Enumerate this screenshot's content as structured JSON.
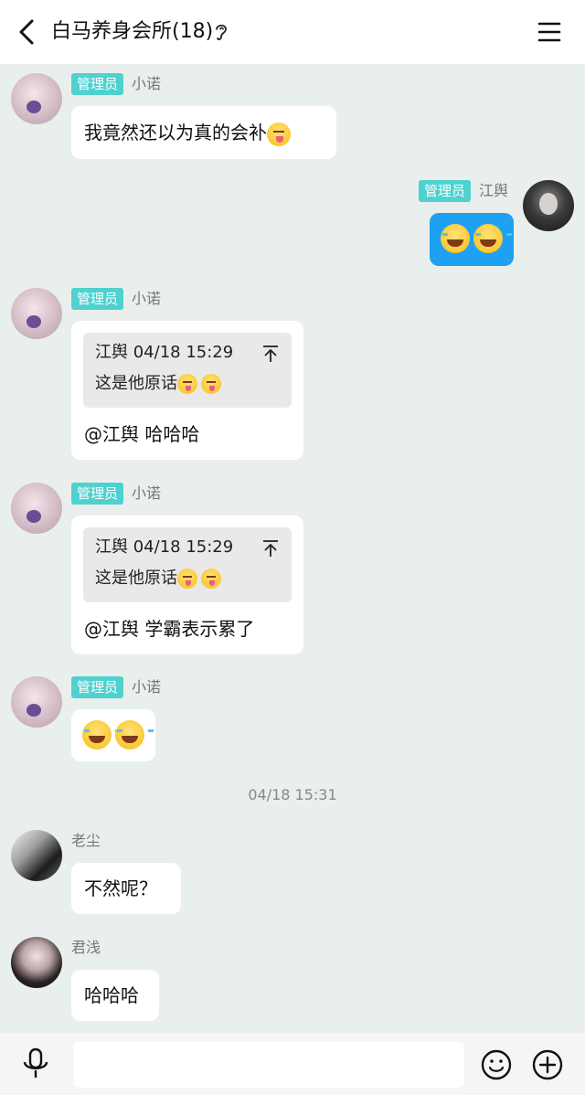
{
  "header": {
    "title": "白马养身会所(18)",
    "back_icon": "chevron-left-icon",
    "status_icon": "ear-icon",
    "menu_icon": "hamburger-menu-icon"
  },
  "badge_label": "管理员",
  "messages": [
    {
      "sender": "小诺",
      "admin": true,
      "side": "left",
      "text": "我竟然还以为真的会补",
      "emoji": [
        "tongue"
      ]
    },
    {
      "sender": "江舆",
      "admin": true,
      "side": "right",
      "text": "",
      "emoji": [
        "laugh",
        "laugh"
      ]
    },
    {
      "sender": "小诺",
      "admin": true,
      "side": "left",
      "quote": {
        "author": "江舆",
        "time": "04/18 15:29",
        "text": "这是他原话",
        "emoji": [
          "tongue",
          "tongue"
        ]
      },
      "text": "@江舆 哈哈哈"
    },
    {
      "sender": "小诺",
      "admin": true,
      "side": "left",
      "quote": {
        "author": "江舆",
        "time": "04/18 15:29",
        "text": "这是他原话",
        "emoji": [
          "tongue",
          "tongue"
        ]
      },
      "text": "@江舆 学霸表示累了"
    },
    {
      "sender": "小诺",
      "admin": true,
      "side": "left",
      "text": "",
      "emoji": [
        "laugh",
        "laugh"
      ]
    },
    {
      "sender": "老尘",
      "admin": false,
      "side": "left",
      "text": "不然呢？"
    },
    {
      "sender": "君浅",
      "admin": false,
      "side": "left",
      "text": "哈哈哈"
    }
  ],
  "timestamp": "04/18 15:31",
  "composer": {
    "placeholder": "",
    "voice_icon": "microphone-icon",
    "emoji_icon": "smiley-icon",
    "plus_icon": "plus-circle-icon"
  },
  "colors": {
    "background": "#e9efec",
    "admin_badge": "#4fd1cf",
    "my_bubble": "#1ea1f2"
  }
}
